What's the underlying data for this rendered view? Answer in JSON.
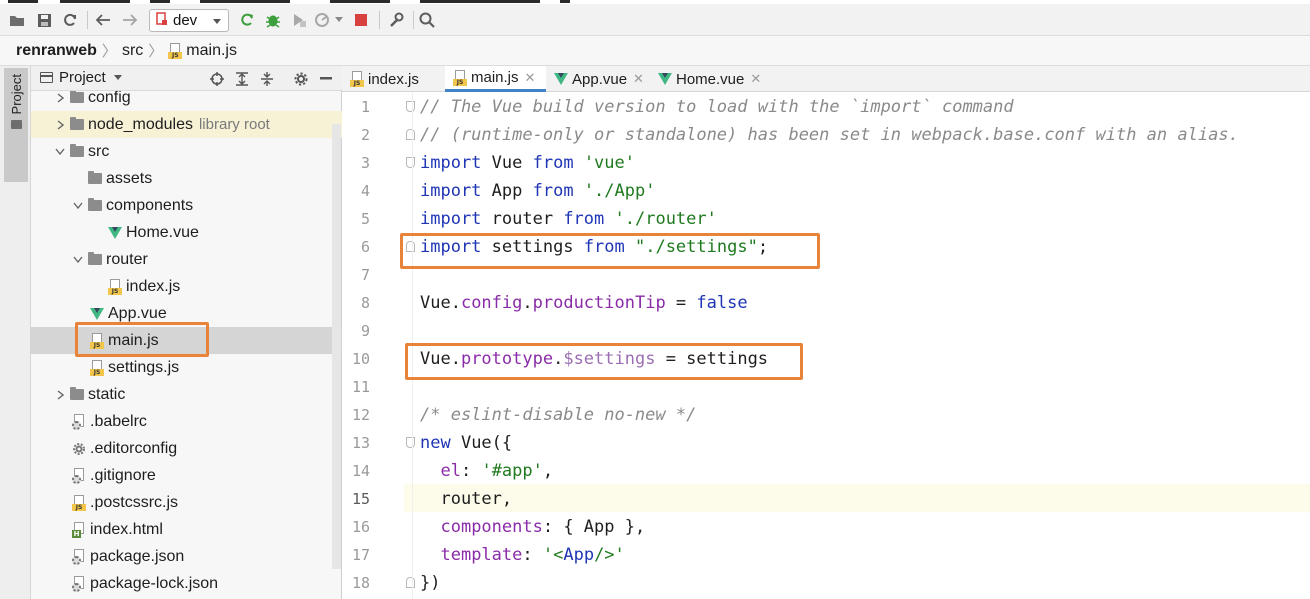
{
  "toolbar": {
    "run_config": "dev",
    "icons": [
      "open-folder-icon",
      "save-icon",
      "sync-icon",
      "back-icon",
      "forward-icon",
      "run-config-icon",
      "run-icon",
      "debug-icon",
      "coverage-icon",
      "profile-icon",
      "stop-icon",
      "settings-wrench-icon",
      "search-icon"
    ],
    "colors": {
      "run": "#3c9e3c",
      "stop": "#d94040",
      "debug": "#3c9e3c"
    }
  },
  "breadcrumb": {
    "items": [
      "renranweb",
      "src",
      "main.js"
    ]
  },
  "left_strip": {
    "project_tab": "Project"
  },
  "project_panel": {
    "title": "Project",
    "tree": [
      {
        "label": "config",
        "type": "folder",
        "depth": 0,
        "expanded": false
      },
      {
        "label": "node_modules",
        "type": "folder",
        "depth": 0,
        "expanded": false,
        "note": "library root"
      },
      {
        "label": "src",
        "type": "folder",
        "depth": 0,
        "expanded": true
      },
      {
        "label": "assets",
        "type": "folder",
        "depth": 1,
        "expanded": null
      },
      {
        "label": "components",
        "type": "folder",
        "depth": 1,
        "expanded": true
      },
      {
        "label": "Home.vue",
        "type": "vue",
        "depth": 2
      },
      {
        "label": "router",
        "type": "folder",
        "depth": 1,
        "expanded": true
      },
      {
        "label": "index.js",
        "type": "js",
        "depth": 2
      },
      {
        "label": "App.vue",
        "type": "vue",
        "depth": 1
      },
      {
        "label": "main.js",
        "type": "js",
        "depth": 1,
        "selected": true
      },
      {
        "label": "settings.js",
        "type": "js",
        "depth": 1
      },
      {
        "label": "static",
        "type": "folder",
        "depth": 0,
        "expanded": false
      },
      {
        "label": ".babelrc",
        "type": "config",
        "depth": 0
      },
      {
        "label": ".editorconfig",
        "type": "gear",
        "depth": 0
      },
      {
        "label": ".gitignore",
        "type": "config",
        "depth": 0
      },
      {
        "label": ".postcssrc.js",
        "type": "js",
        "depth": 0
      },
      {
        "label": "index.html",
        "type": "html",
        "depth": 0
      },
      {
        "label": "package.json",
        "type": "config",
        "depth": 0
      },
      {
        "label": "package-lock.json",
        "type": "config",
        "depth": 0
      }
    ]
  },
  "editor_tabs": [
    {
      "label": "index.js",
      "icon": "js-file-icon",
      "active": false,
      "closable": false
    },
    {
      "label": "main.js",
      "icon": "js-file-icon",
      "active": true,
      "closable": true
    },
    {
      "label": "App.vue",
      "icon": "vue-file-icon",
      "active": false,
      "closable": true
    },
    {
      "label": "Home.vue",
      "icon": "vue-file-icon",
      "active": false,
      "closable": true
    }
  ],
  "editor": {
    "current_line": 15,
    "lines": [
      [
        {
          "t": "// The Vue build version to load with the `import` command",
          "c": "cm"
        }
      ],
      [
        {
          "t": "// (runtime-only or standalone) has been set in webpack.base.conf with an alias.",
          "c": "cm"
        }
      ],
      [
        {
          "t": "import",
          "c": "kw"
        },
        {
          "t": " Vue ",
          "c": ""
        },
        {
          "t": "from",
          "c": "kw"
        },
        {
          "t": " ",
          "c": ""
        },
        {
          "t": "'vue'",
          "c": "str"
        }
      ],
      [
        {
          "t": "import",
          "c": "kw"
        },
        {
          "t": " App ",
          "c": ""
        },
        {
          "t": "from",
          "c": "kw"
        },
        {
          "t": " ",
          "c": ""
        },
        {
          "t": "'./App'",
          "c": "str"
        }
      ],
      [
        {
          "t": "import",
          "c": "kw"
        },
        {
          "t": " router ",
          "c": ""
        },
        {
          "t": "from",
          "c": "kw"
        },
        {
          "t": " ",
          "c": ""
        },
        {
          "t": "'./router'",
          "c": "str"
        }
      ],
      [
        {
          "t": "import",
          "c": "kw"
        },
        {
          "t": " settings ",
          "c": ""
        },
        {
          "t": "from",
          "c": "kw"
        },
        {
          "t": " ",
          "c": ""
        },
        {
          "t": "\"./settings\"",
          "c": "str"
        },
        {
          "t": ";",
          "c": ""
        }
      ],
      [],
      [
        {
          "t": "Vue.",
          "c": ""
        },
        {
          "t": "config",
          "c": "prop"
        },
        {
          "t": ".",
          "c": ""
        },
        {
          "t": "productionTip",
          "c": "prop"
        },
        {
          "t": " = ",
          "c": ""
        },
        {
          "t": "false",
          "c": "kw"
        }
      ],
      [],
      [
        {
          "t": "Vue.",
          "c": ""
        },
        {
          "t": "prototype",
          "c": "prop"
        },
        {
          "t": ".",
          "c": ""
        },
        {
          "t": "$settings",
          "c": "prop2"
        },
        {
          "t": " = settings",
          "c": ""
        }
      ],
      [],
      [
        {
          "t": "/* eslint-disable no-new */",
          "c": "cm"
        }
      ],
      [
        {
          "t": "new",
          "c": "kw"
        },
        {
          "t": " Vue({",
          "c": ""
        }
      ],
      [
        {
          "t": "  ",
          "c": ""
        },
        {
          "t": "el",
          "c": "prop"
        },
        {
          "t": ": ",
          "c": ""
        },
        {
          "t": "'#app'",
          "c": "str"
        },
        {
          "t": ",",
          "c": ""
        }
      ],
      [
        {
          "t": "  router,",
          "c": ""
        }
      ],
      [
        {
          "t": "  ",
          "c": ""
        },
        {
          "t": "components",
          "c": "prop"
        },
        {
          "t": ": { App },",
          "c": ""
        }
      ],
      [
        {
          "t": "  ",
          "c": ""
        },
        {
          "t": "template",
          "c": "prop"
        },
        {
          "t": ": ",
          "c": ""
        },
        {
          "t": "'<",
          "c": "str"
        },
        {
          "t": "App",
          "c": "kw"
        },
        {
          "t": "/>'",
          "c": "str"
        }
      ],
      [
        {
          "t": "})",
          "c": ""
        }
      ]
    ]
  },
  "highlight_boxes_color": "#e8833a"
}
